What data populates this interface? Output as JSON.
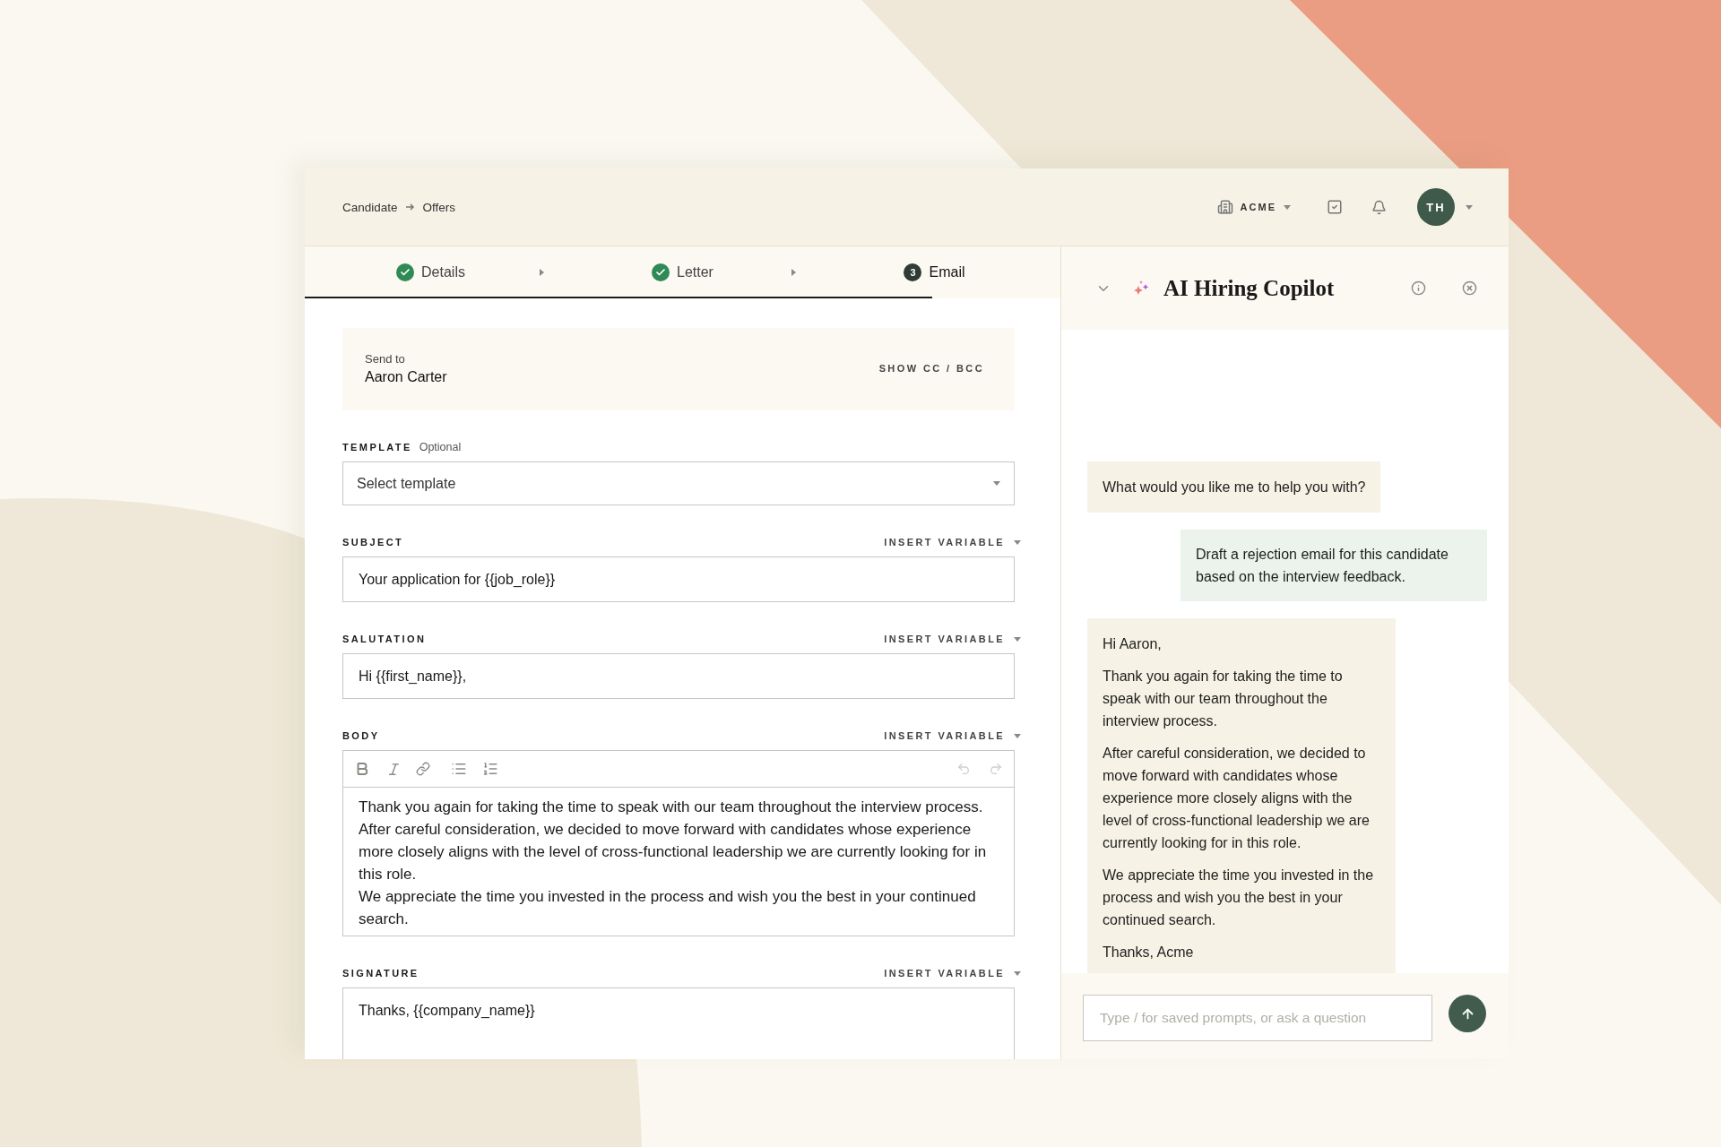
{
  "breadcrumb": [
    "Candidate",
    "Offers"
  ],
  "header": {
    "org": "ACME",
    "avatar": "TH"
  },
  "steps": [
    {
      "label": "Details",
      "kind": "done",
      "selected": false
    },
    {
      "label": "Letter",
      "kind": "done",
      "selected": false
    },
    {
      "label": "Email",
      "kind": "number",
      "number": "3",
      "selected": true
    }
  ],
  "progress": {
    "level": 0.83
  },
  "send_to": {
    "label": "Send to",
    "name": "Aaron Carter",
    "toggle": "SHOW CC / BCC"
  },
  "fields": [
    {
      "kind": "select",
      "label": "TEMPLATE",
      "hint": "Optional",
      "placeholder": "Select template"
    },
    {
      "kind": "input",
      "label": "SUBJECT",
      "action": "INSERT VARIABLE",
      "value": "Your application for {{job_role}}"
    },
    {
      "kind": "input",
      "label": "SALUTATION",
      "action": "INSERT VARIABLE",
      "value": "Hi {{first_name}},"
    },
    {
      "kind": "editor",
      "label": "BODY",
      "action": "INSERT VARIABLE",
      "paragraphs": [
        "Thank you again for taking the time to speak with our team throughout the interview process.",
        "After careful consideration, we decided to move forward with candidates whose experience more closely aligns with the level of cross-functional leadership we are currently looking for in this role.",
        "We appreciate the time you invested in the process and wish you the best in your continued search."
      ]
    },
    {
      "kind": "textarea",
      "label": "SIGNATURE",
      "action": "INSERT VARIABLE",
      "value": "Thanks, {{company_name}}"
    }
  ],
  "copilot": {
    "title": "AI Hiring Copilot",
    "messages": [
      {
        "kind": "assistant",
        "paragraphs": [
          "What would you like me to help you with?"
        ]
      },
      {
        "kind": "user",
        "paragraphs": [
          "Draft a rejection email for this candidate based on the interview feedback."
        ]
      },
      {
        "kind": "assistant",
        "paragraphs": [
          "Hi Aaron,",
          "Thank you again for taking the time to speak with our team throughout the interview process.",
          "After careful consideration, we decided to move forward with candidates whose experience more closely aligns with the level of cross-functional leadership we are currently looking for in this role.",
          "We appreciate the time you invested in the process and wish you the best in your continued search.",
          "Thanks, Acme"
        ]
      }
    ],
    "input_placeholder": "Type / for saved prompts, or ask a question"
  }
}
